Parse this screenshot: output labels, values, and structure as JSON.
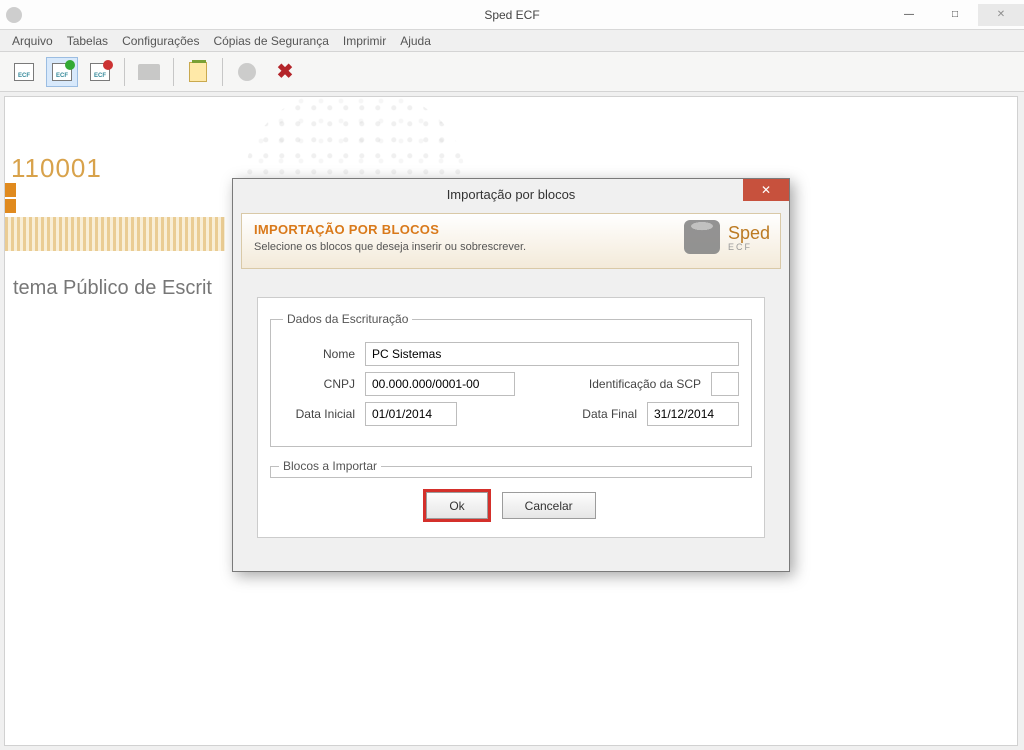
{
  "window": {
    "title": "Sped ECF"
  },
  "menu": {
    "arquivo": "Arquivo",
    "tabelas": "Tabelas",
    "config": "Configurações",
    "copias": "Cópias de Segurança",
    "imprimir": "Imprimir",
    "ajuda": "Ajuda"
  },
  "bg": {
    "code": "110001",
    "slogan": "tema Público de Escrit"
  },
  "dialog": {
    "title": "Importação por blocos",
    "header_title": "IMPORTAÇÃO POR BLOCOS",
    "header_sub": "Selecione os blocos que deseja inserir ou sobrescrever.",
    "brand": "Sped",
    "brand_sub": "ECF",
    "group1_legend": "Dados da Escrituração",
    "labels": {
      "nome": "Nome",
      "cnpj": "CNPJ",
      "ident_scp": "Identificação da SCP",
      "data_inicial": "Data Inicial",
      "data_final": "Data Final"
    },
    "values": {
      "nome": "PC Sistemas",
      "cnpj": "00.000.000/0001-00",
      "ident_scp": "",
      "data_inicial": "01/01/2014",
      "data_final": "31/12/2014"
    },
    "group2_legend": "Blocos a Importar",
    "buttons": {
      "ok": "Ok",
      "cancel": "Cancelar"
    }
  }
}
